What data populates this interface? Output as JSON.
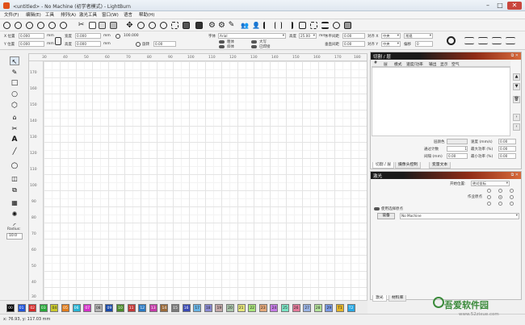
{
  "window": {
    "title": "<untitled> - No Machine (初学者模式) - LightBurn",
    "minimize": "–",
    "maximize": "□",
    "close": "✕"
  },
  "menu": [
    "文件(F)",
    "编辑(E)",
    "工具",
    "排列(A)",
    "激光工具",
    "窗口(W)",
    "语言",
    "帮助(H)"
  ],
  "toolbar1": {
    "icons": [
      "new-file-icon",
      "open-file-icon",
      "save-icon",
      "import-icon",
      "export-icon",
      "undo-icon",
      "scissors-icon",
      "copy-icon",
      "paste-icon",
      "delete-icon",
      "move-icon",
      "zoom-in-icon",
      "zoom-out-icon",
      "zoom-fit-icon",
      "zoom-selection-icon",
      "camera-icon",
      "monitor-icon",
      "settings-gear-icon",
      "settings-gear2-icon",
      "tools-icon",
      "users-icon",
      "user-icon",
      "align-left-icon",
      "align-center-icon",
      "align-right-icon",
      "group-icon",
      "ungroup-icon",
      "distribute-icon",
      "weld-icon",
      "boolean-icon"
    ]
  },
  "toolbar2": {
    "x_label": "X 位置",
    "x_value": "0.000",
    "y_label": "Y 位置",
    "y_value": "0.000",
    "unit": "mm",
    "width_label": "宽度",
    "width_value": "0.000",
    "height_label": "高度",
    "height_value": "0.000",
    "rotate_label": "旋转",
    "rotate_value": "0.00",
    "font_label": "字体",
    "font_value": "Arial",
    "font_height_label": "高度",
    "font_height_value": "25.00",
    "bold": "粗体",
    "italic": "斜体",
    "upper": "大写",
    "welded": "已焊接",
    "hspace_label": "水平间距",
    "hspace_value": "0.00",
    "align_label": "对齐 X",
    "align_value": "中央",
    "normal": "常规",
    "vspace_label": "垂直间距",
    "vspace_value": "0.00",
    "align_y_label": "对齐 Y",
    "align_y_value": "中央",
    "offset_label": "偏移",
    "offset_value": "0"
  },
  "tools": {
    "radius_label": "Radius:",
    "radius_value": "10.0"
  },
  "ruler": {
    "top": [
      "30",
      "40",
      "50",
      "60",
      "70",
      "80",
      "90",
      "100",
      "110",
      "120",
      "130",
      "140",
      "150",
      "160",
      "170",
      "180"
    ],
    "left": [
      "170",
      "160",
      "150",
      "140",
      "130",
      "120",
      "110",
      "100",
      "90",
      "80",
      "70",
      "60",
      "50",
      "40",
      "30"
    ]
  },
  "palette": {
    "swatches": [
      {
        "label": "00",
        "color": "#000000"
      },
      {
        "label": "01",
        "color": "#2156d9"
      },
      {
        "label": "02",
        "color": "#d62a2a"
      },
      {
        "label": "03",
        "color": "#28a83a"
      },
      {
        "label": "04",
        "color": "#c9c92c"
      },
      {
        "label": "05",
        "color": "#e07c1c"
      },
      {
        "label": "06",
        "color": "#28b4d4"
      },
      {
        "label": "07",
        "color": "#d432c8"
      },
      {
        "label": "08",
        "color": "#b4b4b4"
      },
      {
        "label": "09",
        "color": "#1a4aa8"
      },
      {
        "label": "10",
        "color": "#4a8a2a"
      },
      {
        "label": "11",
        "color": "#c43838"
      },
      {
        "label": "12",
        "color": "#2a7ac4"
      },
      {
        "label": "13",
        "color": "#c43aa8"
      },
      {
        "label": "14",
        "color": "#9a6a3a"
      },
      {
        "label": "15",
        "color": "#7a7a7a"
      },
      {
        "label": "16",
        "color": "#3a4ab4"
      },
      {
        "label": "17",
        "color": "#6ab4e4"
      },
      {
        "label": "18",
        "color": "#8a8ad4"
      },
      {
        "label": "19",
        "color": "#c4a8a8"
      },
      {
        "label": "20",
        "color": "#a8c4a8"
      },
      {
        "label": "21",
        "color": "#e4e47a"
      },
      {
        "label": "22",
        "color": "#a8e47a"
      },
      {
        "label": "23",
        "color": "#e4a87a"
      },
      {
        "label": "24",
        "color": "#c47ae4"
      },
      {
        "label": "25",
        "color": "#7ae4c4"
      },
      {
        "label": "26",
        "color": "#e47a9a"
      },
      {
        "label": "27",
        "color": "#9ab4e4"
      },
      {
        "label": "28",
        "color": "#b4e49a"
      },
      {
        "label": "29",
        "color": "#7a9ae4"
      },
      {
        "label": "T1",
        "color": "#e4b428"
      },
      {
        "label": "T2",
        "color": "#28a8e4"
      }
    ]
  },
  "status": {
    "coords": "x: 76.93, y: 117.03 mm"
  },
  "cuts_panel": {
    "title": "切割 / 层",
    "columns": [
      "#",
      "层",
      "模式",
      "速度/功率",
      "输出",
      "显示",
      "空气"
    ],
    "layer_color_label": "层颜色",
    "speed_label": "速度 (mm/s)",
    "passes_label": "通过计数",
    "passes_value": "1",
    "max_power_label": "最大功率 (%)",
    "speed_value": "0.00",
    "max_power_value": "0.00",
    "interval_label": "间隔 (mm)",
    "interval_value": "0.00",
    "min_power_label": "最小功率 (%)",
    "min_power_value": "0.00",
    "tabs": [
      "切割 / 层",
      "摄像头控制",
      "变量文本"
    ]
  },
  "laser_panel": {
    "title": "激光",
    "start_label": "开始位置:",
    "start_value": "绝对坐标",
    "job_origin_label": "作业原点",
    "use_selection": "使用选择原点",
    "device_button": "设备",
    "device_value": "No Machine",
    "tabs": [
      "激光",
      "材料库"
    ]
  },
  "watermark": {
    "text": "吾爱软件园",
    "url": "www.52zixue.com"
  }
}
